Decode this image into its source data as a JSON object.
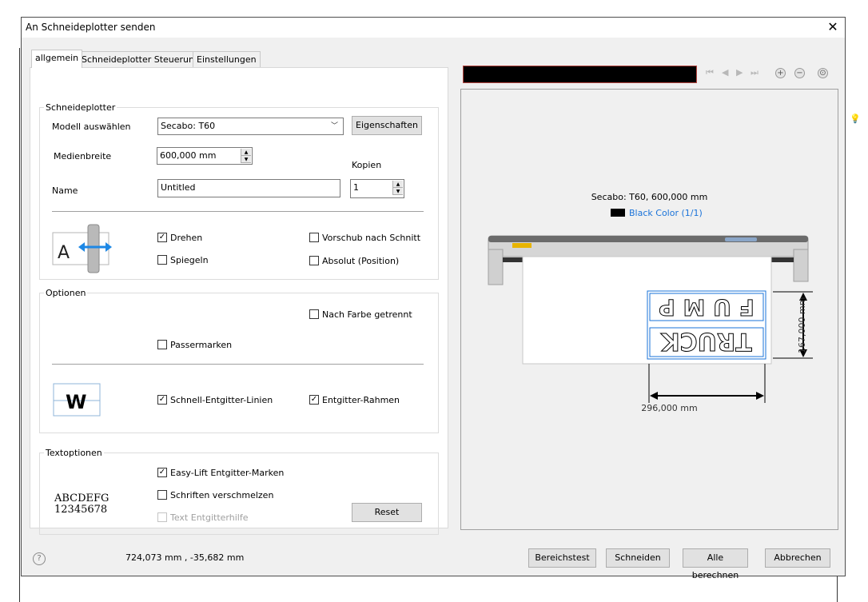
{
  "window": {
    "title": "An Schneideplotter senden"
  },
  "tabs": [
    {
      "label": "allgemein"
    },
    {
      "label": "Schneideplotter Steuerung"
    },
    {
      "label": "Einstellungen"
    }
  ],
  "plotter_group": {
    "legend": "Schneideplotter",
    "model_label": "Modell auswählen",
    "model_value": "Secabo: T60",
    "properties_button": "Eigenschaften",
    "media_width_label": "Medienbreite",
    "media_width_value": "600,000 mm",
    "copies_label": "Kopien",
    "copies_value": "1",
    "name_label": "Name",
    "name_value": "Untitled",
    "rotate_label": "Drehen",
    "rotate_checked": true,
    "mirror_label": "Spiegeln",
    "mirror_checked": false,
    "feed_label": "Vorschub nach Schnitt",
    "feed_checked": false,
    "absolute_label": "Absolut (Position)",
    "absolute_checked": false
  },
  "options_group": {
    "legend": "Optionen",
    "by_color_label": "Nach Farbe getrennt",
    "by_color_checked": false,
    "registration_label": "Passermarken",
    "registration_checked": false,
    "weed_lines_label": "Schnell-Entgitter-Linien",
    "weed_lines_checked": true,
    "weed_frame_label": "Entgitter-Rahmen",
    "weed_frame_checked": true,
    "weed_icon_letter": "W"
  },
  "text_group": {
    "legend": "Textoptionen",
    "easy_lift_label": "Easy-Lift Entgitter-Marken",
    "easy_lift_checked": true,
    "merge_fonts_label": "Schriften verschmelzen",
    "merge_fonts_checked": false,
    "text_weed_label": "Text Entgitterhilfe",
    "text_weed_checked": false,
    "sample_line1": "ABCDEFG",
    "sample_line2": "12345678",
    "reset_button": "Reset"
  },
  "rotate_icon_letter": "A",
  "preview": {
    "device_label": "Secabo: T60,  600,000 mm",
    "color_label": "Black Color (1/1)",
    "color_swatch": "#000000",
    "height_dim": "167,000 mm",
    "width_dim": "296,000 mm",
    "design_text_top": "F U M P",
    "design_text_bottom": "TRUCK"
  },
  "footer": {
    "help_icon": "?",
    "coordinates": "724,073 mm , -35,682 mm",
    "area_test_button": "Bereichstest",
    "cut_button": "Schneiden",
    "calc_all_button": "Alle berechnen",
    "cancel_button": "Abbrechen"
  },
  "colors": {
    "accent_blue": "#1a73d9",
    "dimension_line": "#000000"
  }
}
